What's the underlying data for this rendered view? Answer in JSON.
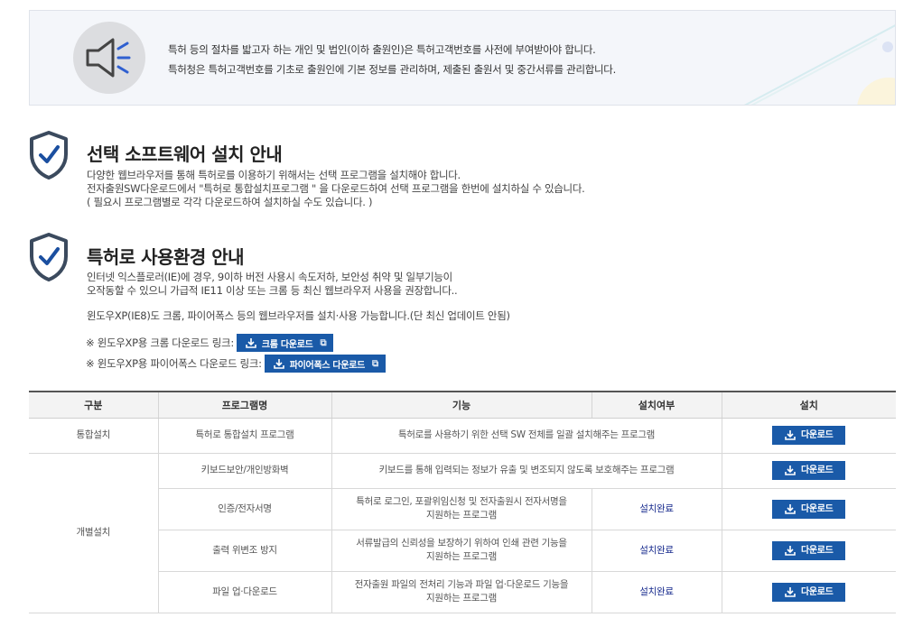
{
  "notice": {
    "icon": "megaphone-icon",
    "line1": "특허 등의 절차를 밟고자 하는 개인 및 법인(이하 출원인)은 특허고객번호를 사전에 부여받아야 합니다.",
    "line2": "특허청은 특허고객번호를 기초로 출원인에 기본 정보를 관리하며, 제출된 출원서 및 중간서류를 관리합니다."
  },
  "section1": {
    "title": "선택 소프트웨어 설치 안내",
    "lines": [
      "다양한 웹브라우저를 통해 특허로를 이용하기 위해서는 선택 프로그램을 설치해야 합니다.",
      "전자출원SW다운로드에서 \"특허로 통합설치프로그램 \" 을 다운로드하여 선택 프로그램을 한번에 설치하실 수 있습니다.",
      "( 필요시 프로그램별로 각각 다운로드하여 설치하실 수도 있습니다. )"
    ]
  },
  "section2": {
    "title": "특허로 사용환경 안내",
    "lines": [
      "인터넷 익스플로러(IE)에 경우, 9이하 버전 사용시 속도저하, 보안성 취약 및 일부기능이",
      "오작동할 수 있으니 가급적 IE11 이상 또는 크롬 등 최신 웹브라우저 사용을 권장합니다..",
      "윈도우XP(IE8)도 크롬, 파이어폭스 등의 웹브라우저를 설치·사용 가능합니다.(단 최신 업데이트 안됨)"
    ],
    "chrome_link_label": "※ 윈도우XP용 크롬 다운로드 링크:",
    "chrome_button": "크롬 다운로드",
    "firefox_link_label": "※ 윈도우XP용 파이어폭스 다운로드 링크:",
    "firefox_button": "파이어폭스 다운로드"
  },
  "table": {
    "headers": [
      "구분",
      "프로그램명",
      "기능",
      "설치여부",
      "설치"
    ],
    "group1": "통합설치",
    "group2": "개별설치",
    "download_label": "다운로드",
    "rows": [
      {
        "name": "특허로 통합설치 프로그램",
        "func1": "특허로를 사용하기 위한 선택 SW 전체를 일괄 설치해주는 프로그램",
        "func2": "",
        "status": ""
      },
      {
        "name": "키보드보안/개인방화벽",
        "func1": "키보드를 통해 입력되는 정보가 유출 및 변조되지 않도록 보호해주는 프로그램",
        "func2": "",
        "status": ""
      },
      {
        "name": "인증/전자서명",
        "func1": "특허로 로그인, 포괄위임신청 및 전자출원시 전자서명을",
        "func2": "지원하는 프로그램",
        "status": "설치완료"
      },
      {
        "name": "출력 위변조 방지",
        "func1": "서류발급의 신뢰성을 보장하기 위하여 인쇄 관련 기능을",
        "func2": "지원하는 프로그램",
        "status": "설치완료"
      },
      {
        "name": "파일 업·다운로드",
        "func1": "전자출원 파일의 전처리 기능과 파일 업·다운로드 기능을",
        "func2": "지원하는 프로그램",
        "status": "설치완료"
      }
    ]
  },
  "colors": {
    "accent": "#1a5aa8",
    "status": "#1a2d8f"
  }
}
